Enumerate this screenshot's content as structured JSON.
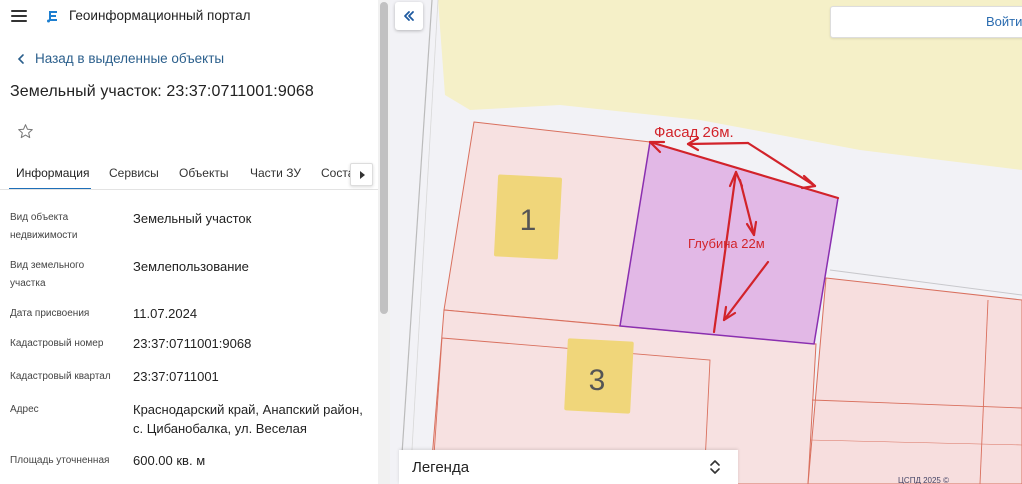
{
  "app": {
    "title": "Геоинформационный портал",
    "menu_icon": "hamburger-menu-icon",
    "logo_icon": "portal-logo-icon"
  },
  "nav": {
    "back_label": "Назад в выделенные объекты"
  },
  "object": {
    "title": "Земельный участок: 23:37:0711001:9068"
  },
  "tabs": [
    {
      "label": "Информация",
      "active": true
    },
    {
      "label": "Сервисы"
    },
    {
      "label": "Объекты"
    },
    {
      "label": "Части ЗУ"
    },
    {
      "label": "Соста"
    }
  ],
  "info": [
    {
      "label": "Вид объекта недвижимости",
      "value": "Земельный участок"
    },
    {
      "label": "Вид земельного участка",
      "value": "Землепользование"
    },
    {
      "label": "Дата присвоения",
      "value": "11.07.2024"
    },
    {
      "label": "Кадастровый номер",
      "value": "23:37:0711001:9068"
    },
    {
      "label": "Кадастровый квартал",
      "value": "23:37:0711001"
    },
    {
      "label": "Адрес",
      "value": "Краснодарский край, Анапский район, с. Цибанобалка, ул. Веселая"
    },
    {
      "label": "Площадь уточненная",
      "value": "600.00 кв. м"
    }
  ],
  "map": {
    "login_label": "Войти",
    "legend_label": "Легенда",
    "copyright": "ЦСПД 2025 ©",
    "annotations": {
      "facade": "Фасад 26м.",
      "depth": "Глубина 22м"
    },
    "plot_numbers": [
      "1",
      "3"
    ],
    "colors": {
      "selected_fill": "#e2b8e6",
      "selected_stroke": "#8a2fb0",
      "parcel_fill": "#f7e1e1",
      "parcel_stroke": "#d9705e",
      "road_fill": "#f5f0c8",
      "annotation_red": "#d2232a",
      "label_yellow": "#f0d67a"
    }
  }
}
